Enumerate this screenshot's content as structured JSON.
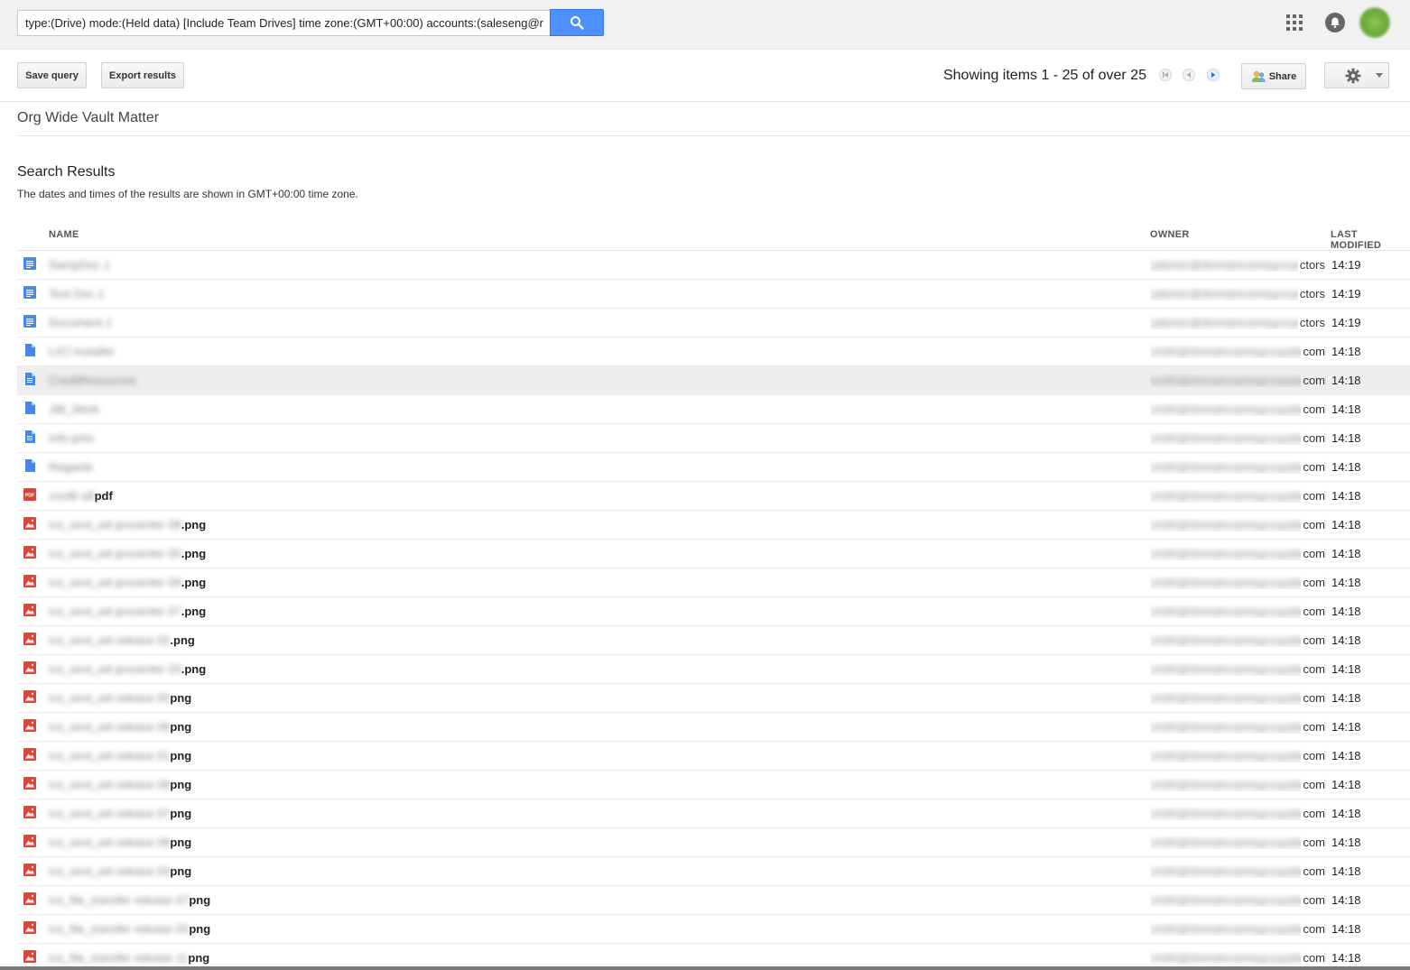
{
  "search": {
    "query": "type:(Drive) mode:(Held data) [Include Team Drives] time zone:(GMT+00:00) accounts:(saleseng@r"
  },
  "header": {
    "apps_icon": "apps-grid-icon",
    "notifications_icon": "bell-icon",
    "avatar": "user-avatar"
  },
  "toolbar": {
    "save_query_label": "Save query",
    "export_results_label": "Export results",
    "paging_text": "Showing items 1 - 25 of over 25",
    "share_label": "Share"
  },
  "matter": {
    "title": "Org Wide Vault Matter"
  },
  "results": {
    "heading": "Search Results",
    "note": "The dates and times of the results are shown in GMT+00:00 time zone.",
    "columns": {
      "name": "NAME",
      "owner": "OWNER",
      "modified": "LAST MODIFIED"
    },
    "rows": [
      {
        "icon": "doc",
        "name_blur": "SampDoc 1",
        "ext": "",
        "owner_blur": "salesen@domainnamegroupa",
        "owner_tail": "ctors",
        "modified": "14:19"
      },
      {
        "icon": "doc",
        "name_blur": "Test Doc 1",
        "ext": "",
        "owner_blur": "salesen@domainnamegroupa",
        "owner_tail": "ctors",
        "modified": "14:19"
      },
      {
        "icon": "doc",
        "name_blur": "Document 1",
        "ext": "",
        "owner_blur": "salesen@domainnamegroupa",
        "owner_tail": "ctors",
        "modified": "14:19"
      },
      {
        "icon": "file",
        "name_blur": "LICI Installer",
        "ext": "",
        "owner_blur": "smith@domainnamegroupalescom",
        "owner_tail": "com",
        "modified": "14:18"
      },
      {
        "icon": "text",
        "name_blur": "CreditResources",
        "ext": "",
        "owner_blur": "smith@domainnamegroupalescom",
        "owner_tail": "com",
        "modified": "14:18",
        "highlight": true
      },
      {
        "icon": "file",
        "name_blur": "JIB_Work",
        "ext": "",
        "owner_blur": "smith@domainnamegroupalescom",
        "owner_tail": "com",
        "modified": "14:18"
      },
      {
        "icon": "text",
        "name_blur": "Info prim",
        "ext": "",
        "owner_blur": "smith@domainnamegroupalescom",
        "owner_tail": "com",
        "modified": "14:18"
      },
      {
        "icon": "file",
        "name_blur": "Regards",
        "ext": "",
        "owner_blur": "smith@domainnamegroupalescom",
        "owner_tail": "com",
        "modified": "14:18"
      },
      {
        "icon": "pdf",
        "name_blur": "credit sill",
        "ext": "pdf",
        "owner_blur": "smith@domainnamegroupalescom",
        "owner_tail": "com",
        "modified": "14:18"
      },
      {
        "icon": "image",
        "name_blur": "ics_sent_wil presenter 08",
        "ext": ".png",
        "owner_blur": "smith@domainnamegroupalescom",
        "owner_tail": "com",
        "modified": "14:18"
      },
      {
        "icon": "image",
        "name_blur": "ics_sent_wil presenter 05",
        "ext": ".png",
        "owner_blur": "smith@domainnamegroupalescom",
        "owner_tail": "com",
        "modified": "14:18"
      },
      {
        "icon": "image",
        "name_blur": "ics_sent_wil presenter 09",
        "ext": ".png",
        "owner_blur": "smith@domainnamegroupalescom",
        "owner_tail": "com",
        "modified": "14:18"
      },
      {
        "icon": "image",
        "name_blur": "ics_sent_wil presenter 07",
        "ext": ".png",
        "owner_blur": "smith@domainnamegroupalescom",
        "owner_tail": "com",
        "modified": "14:18"
      },
      {
        "icon": "image",
        "name_blur": "ics_sent_wil release 02",
        "ext": ".png",
        "owner_blur": "smith@domainnamegroupalescom",
        "owner_tail": "com",
        "modified": "14:18"
      },
      {
        "icon": "image",
        "name_blur": "ics_sent_wil presenter 03",
        "ext": ".png",
        "owner_blur": "smith@domainnamegroupalescom",
        "owner_tail": "com",
        "modified": "14:18"
      },
      {
        "icon": "image",
        "name_blur": "ics_sent_wil release 05",
        "ext": "png",
        "owner_blur": "smith@domainnamegroupalescom",
        "owner_tail": "com",
        "modified": "14:18"
      },
      {
        "icon": "image",
        "name_blur": "ics_sent_wil release 06",
        "ext": "png",
        "owner_blur": "smith@domainnamegroupalescom",
        "owner_tail": "com",
        "modified": "14:18"
      },
      {
        "icon": "image",
        "name_blur": "ics_sent_wil release 01",
        "ext": "png",
        "owner_blur": "smith@domainnamegroupalescom",
        "owner_tail": "com",
        "modified": "14:18"
      },
      {
        "icon": "image",
        "name_blur": "ics_sent_wil release 08",
        "ext": "png",
        "owner_blur": "smith@domainnamegroupalescom",
        "owner_tail": "com",
        "modified": "14:18"
      },
      {
        "icon": "image",
        "name_blur": "ics_sent_wil release 07",
        "ext": "png",
        "owner_blur": "smith@domainnamegroupalescom",
        "owner_tail": "com",
        "modified": "14:18"
      },
      {
        "icon": "image",
        "name_blur": "ics_sent_wil release 09",
        "ext": "png",
        "owner_blur": "smith@domainnamegroupalescom",
        "owner_tail": "com",
        "modified": "14:18"
      },
      {
        "icon": "image",
        "name_blur": "ics_sent_wil release 03",
        "ext": "png",
        "owner_blur": "smith@domainnamegroupalescom",
        "owner_tail": "com",
        "modified": "14:18"
      },
      {
        "icon": "image",
        "name_blur": "ics_file_transfer release 07",
        "ext": "png",
        "owner_blur": "smith@domainnamegroupalescom",
        "owner_tail": "com",
        "modified": "14:18"
      },
      {
        "icon": "image",
        "name_blur": "ics_file_transfer release 05",
        "ext": "png",
        "owner_blur": "smith@domainnamegroupalescom",
        "owner_tail": "com",
        "modified": "14:18"
      },
      {
        "icon": "image",
        "name_blur": "ics_file_transfer release 11",
        "ext": "png",
        "owner_blur": "smith@domainnamegroupalescom",
        "owner_tail": "com",
        "modified": "14:18"
      }
    ]
  },
  "colors": {
    "accent": "#4d90fe",
    "doc_icon": "#4a86e8",
    "image_icon": "#db4437",
    "pdf_icon": "#db4437"
  }
}
